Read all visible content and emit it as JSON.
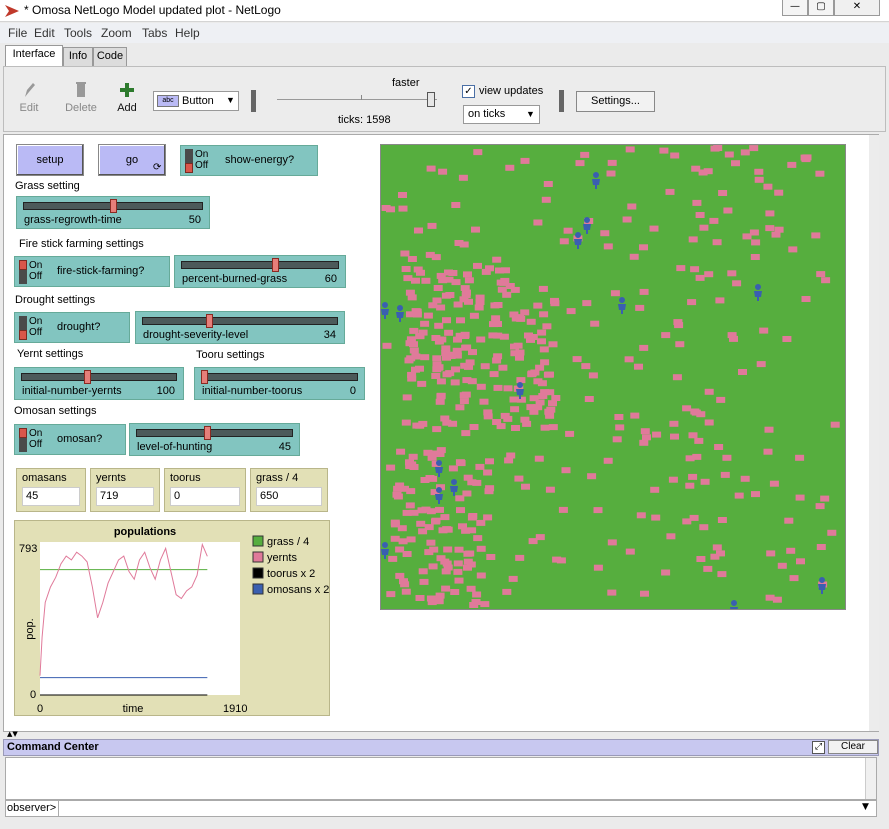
{
  "window": {
    "title": "* Omosa NetLogo Model updated plot - NetLogo"
  },
  "menu": [
    "File",
    "Edit",
    "Tools",
    "Zoom",
    "Tabs",
    "Help"
  ],
  "tabs": [
    "Interface",
    "Info",
    "Code"
  ],
  "toolbar": {
    "edit_label": "Edit",
    "delete_label": "Delete",
    "add_label": "Add",
    "widget_type": "Button",
    "speed_label": "faster",
    "speed_level": 0.96,
    "ticks_label": "ticks: 1598",
    "view_updates_label": "view updates",
    "view_updates_checked": true,
    "update_mode": "on ticks",
    "settings_label": "Settings..."
  },
  "buttons": {
    "setup": "setup",
    "go": "go"
  },
  "labels": {
    "grass": "Grass setting",
    "fire": "Fire stick farming settings",
    "drought": "Drought settings",
    "yernt": "Yernt settings",
    "tooru": "Tooru settings",
    "omosan": "Omosan settings"
  },
  "switches": {
    "show_energy": {
      "name": "show-energy?",
      "on": true
    },
    "fire_stick": {
      "name": "fire-stick-farming?",
      "on": false
    },
    "drought": {
      "name": "drought?",
      "on": true
    },
    "omosan": {
      "name": "omosan?",
      "on": false
    },
    "on_label": "On",
    "off_label": "Off"
  },
  "sliders": {
    "grass_regrowth": {
      "name": "grass-regrowth-time",
      "value": "50",
      "fraction": 0.5
    },
    "percent_burned": {
      "name": "percent-burned-grass",
      "value": "60",
      "fraction": 0.6
    },
    "drought_severity": {
      "name": "drought-severity-level",
      "value": "34",
      "fraction": 0.34
    },
    "initial_yernts": {
      "name": "initial-number-yernts",
      "value": "100",
      "fraction": 0.42
    },
    "initial_toorus": {
      "name": "initial-number-toorus",
      "value": "0",
      "fraction": 0.0
    },
    "level_hunting": {
      "name": "level-of-hunting",
      "value": "45",
      "fraction": 0.45
    }
  },
  "monitors": [
    {
      "name": "omasans",
      "value": "45"
    },
    {
      "name": "yernts",
      "value": "719"
    },
    {
      "name": "toorus",
      "value": "0"
    },
    {
      "name": "grass / 4",
      "value": "650"
    }
  ],
  "plot": {
    "title": "populations",
    "ylabel": "pop.",
    "xlabel": "time",
    "x_min": "0",
    "x_max": "1910",
    "y_min": "0",
    "y_max": "793"
  },
  "chart_data": {
    "type": "line",
    "title": "populations",
    "xlabel": "time",
    "ylabel": "pop.",
    "xlim": [
      0,
      1910
    ],
    "ylim": [
      0,
      793
    ],
    "x": [
      0,
      20,
      50,
      100,
      150,
      200,
      250,
      300,
      350,
      400,
      450,
      500,
      550,
      600,
      650,
      700,
      750,
      800,
      850,
      900,
      950,
      1000,
      1050,
      1100,
      1150,
      1200,
      1250,
      1300,
      1350,
      1400,
      1450,
      1500,
      1550,
      1598
    ],
    "series": [
      {
        "name": "grass / 4",
        "color": "#56ae3e",
        "values": [
          650,
          650,
          650,
          650,
          650,
          650,
          650,
          650,
          650,
          650,
          650,
          650,
          650,
          650,
          650,
          650,
          650,
          650,
          650,
          650,
          650,
          650,
          650,
          650,
          650,
          650,
          650,
          650,
          650,
          650,
          650,
          650,
          650,
          650
        ]
      },
      {
        "name": "yernts",
        "color": "#e07a9a",
        "values": [
          100,
          300,
          480,
          560,
          610,
          680,
          720,
          700,
          740,
          720,
          690,
          560,
          400,
          480,
          580,
          640,
          700,
          720,
          640,
          600,
          700,
          740,
          660,
          600,
          700,
          760,
          640,
          520,
          500,
          540,
          560,
          620,
          780,
          719
        ]
      },
      {
        "name": "toorus x 2",
        "color": "#000000",
        "values": [
          0,
          0,
          0,
          0,
          0,
          0,
          0,
          0,
          0,
          0,
          0,
          0,
          0,
          0,
          0,
          0,
          0,
          0,
          0,
          0,
          0,
          0,
          0,
          0,
          0,
          0,
          0,
          0,
          0,
          0,
          0,
          0,
          0,
          0
        ]
      },
      {
        "name": "omosans x 2",
        "color": "#3a5fb0",
        "values": [
          90,
          90,
          90,
          90,
          90,
          90,
          90,
          90,
          90,
          90,
          90,
          90,
          90,
          90,
          90,
          90,
          90,
          90,
          90,
          90,
          90,
          90,
          90,
          90,
          90,
          90,
          90,
          90,
          90,
          90,
          90,
          90,
          90,
          90
        ]
      }
    ],
    "legend_position": "right"
  },
  "command_center": {
    "title": "Command Center",
    "clear_label": "Clear",
    "prompt": "observer>"
  },
  "colors": {
    "grass": "#56ae3e",
    "yernt": "#e07a9a",
    "omosan": "#3a5fb0",
    "button": "#babaf5",
    "widget": "#82c5c0",
    "monitor": "#e2e0b6"
  }
}
